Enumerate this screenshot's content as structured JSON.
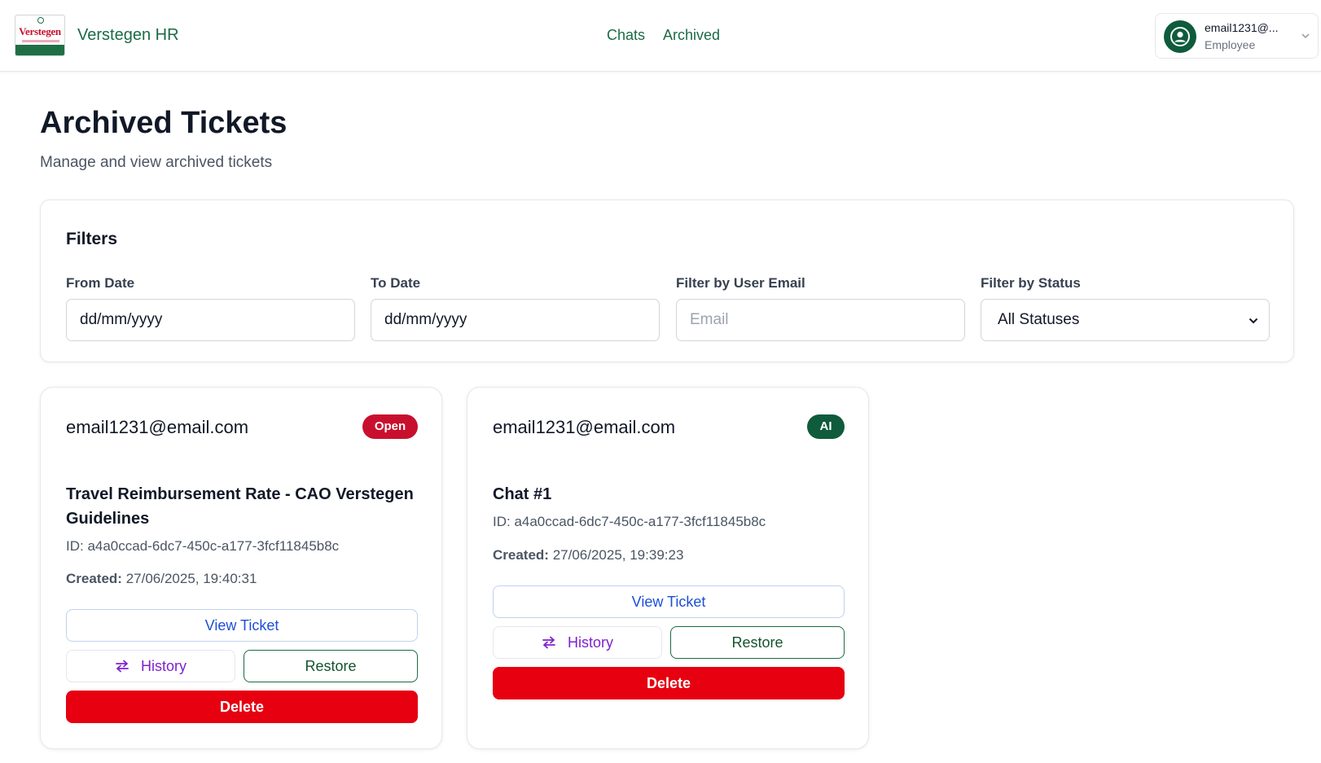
{
  "header": {
    "brand": "Verstegen HR",
    "logo_text": "Verstegen",
    "nav": [
      "Chats",
      "Archived"
    ],
    "user": {
      "email": "email1231@...",
      "role": "Employee"
    }
  },
  "page": {
    "title": "Archived Tickets",
    "subtitle": "Manage and view archived tickets"
  },
  "filters": {
    "title": "Filters",
    "from_date": {
      "label": "From Date",
      "value": "dd/mm/yyyy"
    },
    "to_date": {
      "label": "To Date",
      "value": "dd/mm/yyyy"
    },
    "user_email": {
      "label": "Filter by User Email",
      "placeholder": "Email"
    },
    "status": {
      "label": "Filter by Status",
      "value": "All Statuses"
    }
  },
  "tickets": [
    {
      "email": "email1231@email.com",
      "badge": "Open",
      "badge_color": "#c8102e",
      "title": "Travel Reimbursement Rate - CAO Verstegen Guidelines",
      "id": "ID: a4a0ccad-6dc7-450c-a177-3fcf11845b8c",
      "created_label": "Created:",
      "created_value": "27/06/2025, 19:40:31",
      "view_label": "View Ticket",
      "history_label": "History",
      "restore_label": "Restore",
      "delete_label": "Delete"
    },
    {
      "email": "email1231@email.com",
      "badge": "AI",
      "badge_color": "#0f5b3c",
      "title": "Chat #1",
      "id": "ID: a4a0ccad-6dc7-450c-a177-3fcf11845b8c",
      "created_label": "Created:",
      "created_value": "27/06/2025, 19:39:23",
      "view_label": "View Ticket",
      "history_label": "History",
      "restore_label": "Restore",
      "delete_label": "Delete"
    }
  ],
  "colors": {
    "brand_green": "#1b6b45",
    "delete_red": "#e60010",
    "history_purple": "#7e22ce",
    "view_blue": "#1d4ed8"
  }
}
